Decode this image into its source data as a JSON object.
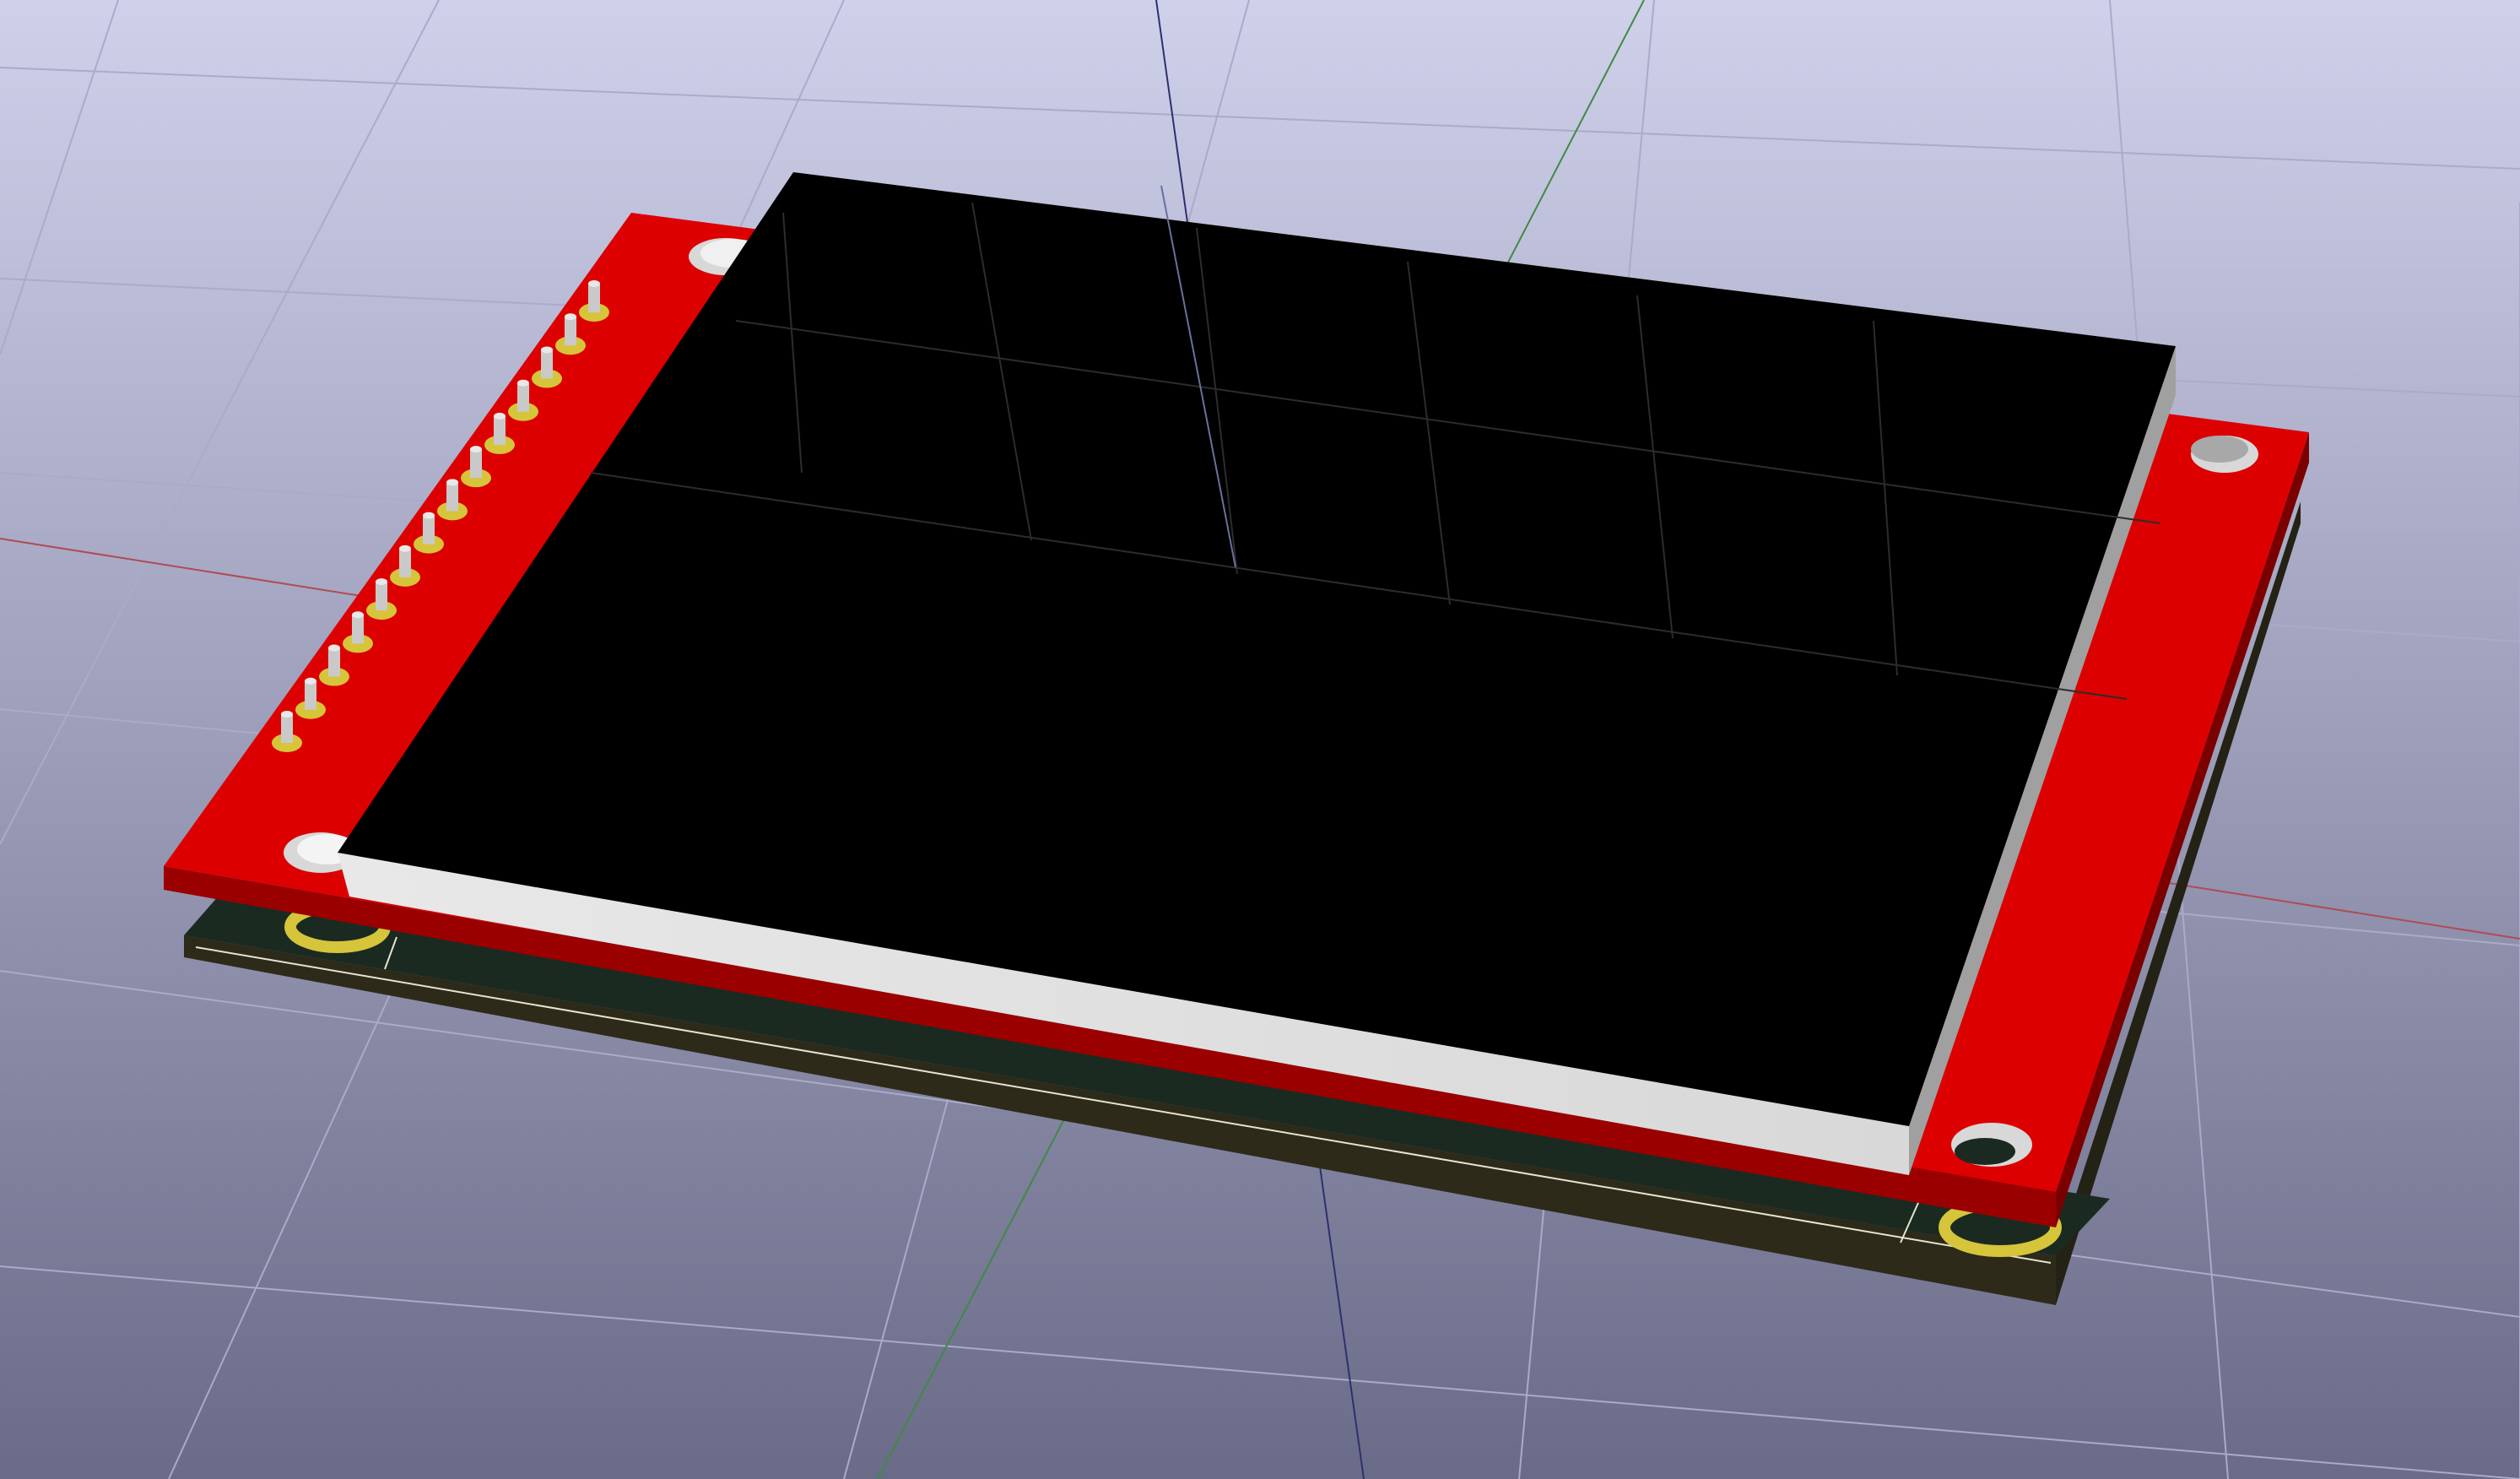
{
  "scene": {
    "background_top": "#cfd0ea",
    "background_bottom": "#6a6b88",
    "grid_color": "#a9abc8",
    "axis_x_color": "#b04b55",
    "axis_y_color": "#3f8a45",
    "axis_z_color": "#2d3070"
  },
  "model": {
    "carrier_pcb_color": "#1b2a20",
    "carrier_pcb_edge_color": "#2d2a1a",
    "module_pcb_color": "#dc0000",
    "module_pcb_side_color": "#9a0000",
    "lcd_glass_color": "#000000",
    "lcd_frame_color": "#e3e3e3",
    "lcd_frame_side_color": "#a0a0a0",
    "pad_color": "#d6c43a",
    "pin_color": "#c9c9c9",
    "pin_count": 14
  }
}
